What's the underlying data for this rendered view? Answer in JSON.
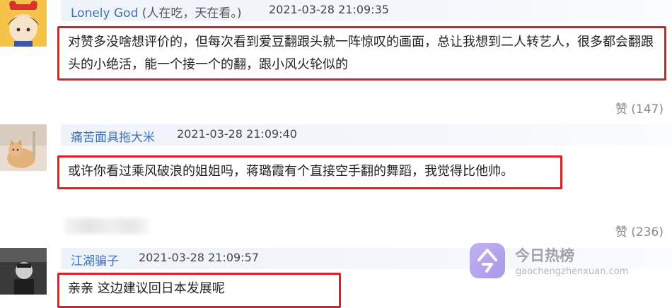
{
  "comments": [
    {
      "username": "Lonely God",
      "signature": "(人在吃，天在看。)",
      "timestamp": "2021-03-28 21:09:35",
      "text": "对赞多没啥想评价的，但每次看到爱豆翻跟头就一阵惊叹的画面，总让我想到二人转艺人，很多都会翻跟头的小绝活，能一个接一个的翻，跟小风火轮似的",
      "likes": "赞 (147)"
    },
    {
      "username": "痛苦面具拖大米",
      "timestamp": "2021-03-28 21:09:40",
      "text": "或许你看过乘风破浪的姐姐吗，蒋璐霞有个直接空手翻的舞蹈，我觉得比他帅。",
      "likes": "赞 (236)"
    },
    {
      "username": "江湖骗子",
      "timestamp": "2021-03-28 21:09:57",
      "text": "亲亲 这边建议回日本发展呢"
    }
  ],
  "watermark": {
    "title": "今日热榜",
    "url": "gaochengzhenxuan.com"
  },
  "colors": {
    "username": "#3f6fb5",
    "highlight_border": "#e01e24",
    "header_bg": "#eef3fa",
    "likes": "#8a8a8a"
  }
}
